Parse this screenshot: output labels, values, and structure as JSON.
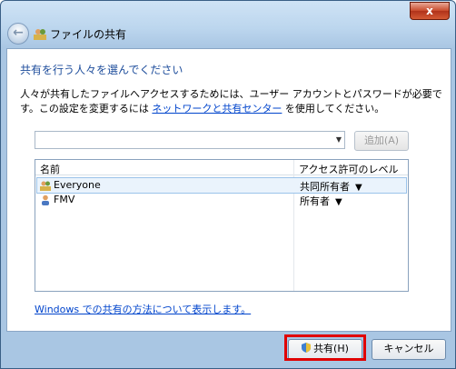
{
  "window": {
    "title": "ファイルの共有",
    "close_label": "x",
    "back_label": "←"
  },
  "content": {
    "heading": "共有を行う人々を選んでください",
    "desc_part1": "人々が共有したファイルへアクセスするためには、ユーザー アカウントとパスワードが必要です。この設定を変更するには ",
    "desc_link": "ネットワークと共有センター",
    "desc_part2": " を使用してください。",
    "combo_value": "",
    "add_button": "追加(A)"
  },
  "list": {
    "columns": {
      "name": "名前",
      "level": "アクセス許可のレベル"
    },
    "rows": [
      {
        "name": "Everyone",
        "level": "共同所有者",
        "selected": true
      },
      {
        "name": "FMV",
        "level": "所有者",
        "selected": false
      }
    ]
  },
  "help_link": "Windows での共有の方法について表示します。",
  "footer": {
    "share_button": "共有(H)",
    "cancel_button": "キャンセル"
  },
  "colors": {
    "heading": "#1f4e9c",
    "link": "#0044cc",
    "highlight": "#e00000"
  }
}
